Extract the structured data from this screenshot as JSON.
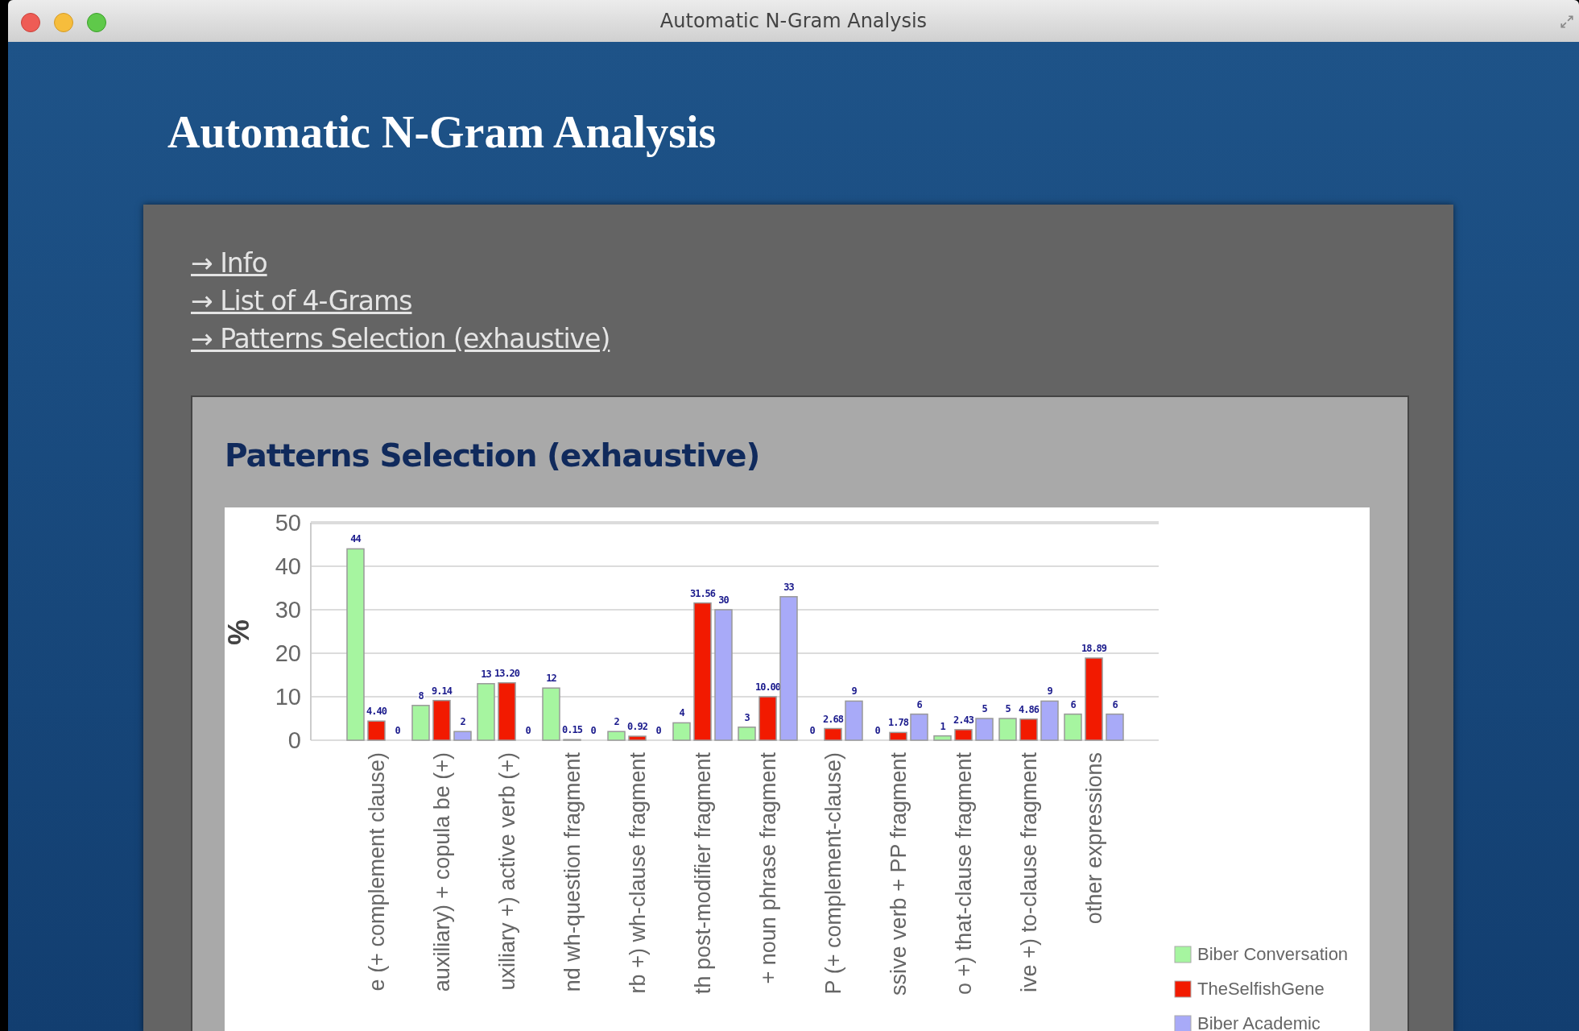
{
  "window": {
    "title": "Automatic N-Gram Analysis"
  },
  "heading": "Automatic N-Gram Analysis",
  "links": [
    {
      "label": "→ Info"
    },
    {
      "label": "→ List of 4-Grams"
    },
    {
      "label": "→ Patterns Selection (exhaustive)"
    }
  ],
  "section": {
    "title": "Patterns Selection (exhaustive)",
    "chart_data": {
      "type": "bar",
      "ylabel": "%",
      "categories": [
        "e (+ complement clause)",
        "auxiliary) + copula be (+)",
        "uxiliary +) active verb (+)",
        "nd wh-question fragment",
        "rb +) wh-clause fragment",
        "th post-modifier fragment",
        "+ noun phrase fragment",
        "P (+ complement-clause)",
        "ssive verb + PP fragment",
        "o +) that-clause fragment",
        "ive +) to-clause fragment",
        "other expressions"
      ],
      "series": [
        {
          "name": "Biber Conversation",
          "color": "#a6f5a0",
          "values": [
            44,
            8,
            13,
            12,
            2,
            4,
            3,
            0,
            0,
            1,
            5,
            6
          ]
        },
        {
          "name": "TheSelfishGene",
          "color": "#f21a00",
          "values": [
            4.4,
            9.14,
            13.2,
            0.15,
            0.92,
            31.56,
            10.0,
            2.68,
            1.78,
            2.43,
            4.86,
            18.89
          ]
        },
        {
          "name": "Biber Academic",
          "color": "#a8aaf8",
          "values": [
            0,
            2,
            0,
            0,
            0,
            30,
            33,
            9,
            6,
            5,
            9,
            6
          ]
        }
      ],
      "value_labels": [
        [
          "44",
          "8",
          "13",
          "12",
          "2",
          "4",
          "3",
          "0",
          "0",
          "1",
          "5",
          "6"
        ],
        [
          "4.40",
          "9.14",
          "13.20",
          "0.15",
          "0.92",
          "31.56",
          "10.00",
          "2.68",
          "1.78",
          "2.43",
          "4.86",
          "18.89"
        ],
        [
          "0",
          "2",
          "0",
          "0",
          "0",
          "30",
          "33",
          "9",
          "6",
          "5",
          "9",
          "6"
        ]
      ],
      "ylim": [
        0,
        50
      ],
      "yticks": [
        0,
        10,
        20,
        30,
        40,
        50
      ],
      "grid": true,
      "legend": "right"
    }
  }
}
